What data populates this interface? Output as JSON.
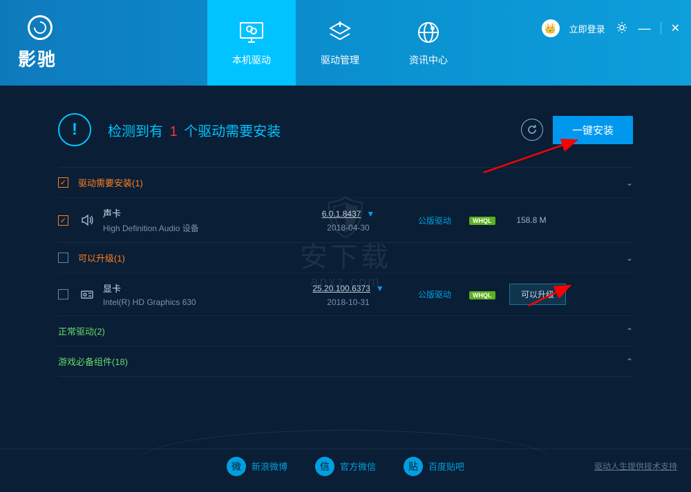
{
  "brand": "影驰",
  "header": {
    "tabs": [
      {
        "label": "本机驱动",
        "active": true
      },
      {
        "label": "驱动管理",
        "active": false
      },
      {
        "label": "资讯中心",
        "active": false
      }
    ],
    "login_label": "立即登录"
  },
  "status": {
    "prefix": "检测到有",
    "count": "1",
    "suffix": "个驱动需要安装",
    "install_all_label": "一键安装"
  },
  "sections": {
    "need_install": {
      "title": "驱动需要安装(1)"
    },
    "can_upgrade": {
      "title": "可以升级(1)"
    },
    "normal": {
      "title": "正常驱动(2)"
    },
    "game_required": {
      "title": "游戏必备组件(18)"
    }
  },
  "drivers": {
    "sound": {
      "name": "声卡",
      "desc": "High Definition Audio 设备",
      "version": "6.0.1.8437",
      "date": "2018-04-30",
      "type": "公版驱动",
      "badge": "WHQL",
      "size": "158.8 M"
    },
    "display": {
      "name": "显卡",
      "desc": "Intel(R) HD Graphics 630",
      "version": "25.20.100.6373",
      "date": "2018-10-31",
      "type": "公版驱动",
      "badge": "WHQL",
      "action_label": "可以升级"
    }
  },
  "footer": {
    "weibo": "新浪微博",
    "wechat": "官方微信",
    "tieba": "百度贴吧",
    "support": "驱动人生提供技术支持"
  },
  "watermark": {
    "text": "安下载",
    "url": "anxz.com"
  }
}
